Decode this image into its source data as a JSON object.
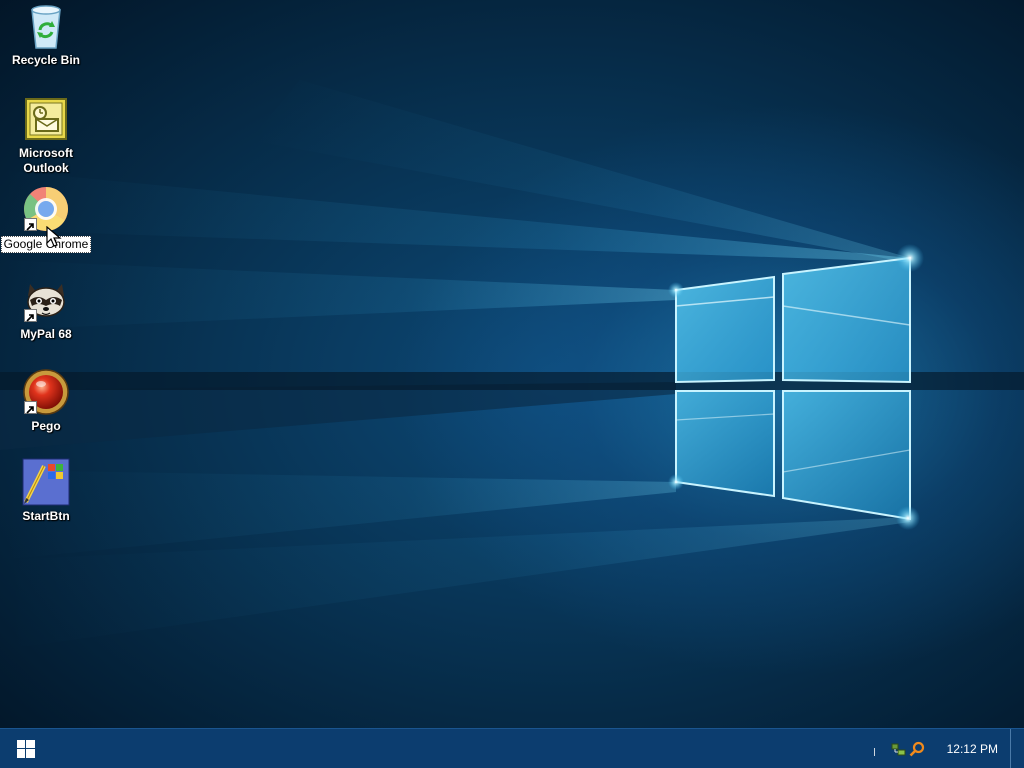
{
  "desktop": {
    "icons": [
      {
        "label": "Recycle Bin",
        "icon": "recycle-bin-icon"
      },
      {
        "label": "Microsoft Outlook",
        "icon": "outlook-icon"
      },
      {
        "label": "Google Chrome",
        "icon": "chrome-icon",
        "selected": true,
        "shortcut": true
      },
      {
        "label": "MyPal 68",
        "icon": "mypal-raccoon-icon",
        "shortcut": true
      },
      {
        "label": "Pego",
        "icon": "pego-red-ball-icon",
        "shortcut": true
      },
      {
        "label": "StartBtn",
        "icon": "startbtn-icon"
      }
    ],
    "wallpaper": "windows-10-hero-light-window",
    "colors": {
      "background_dark": "#031a2e",
      "glow": "#5fd6ff"
    }
  },
  "taskbar": {
    "start_icon": "windows-logo-icon",
    "tray_icons": [
      "network-green-icon",
      "search-orange-icon"
    ],
    "clock": "12:12 PM",
    "colors": {
      "bar": "#0c3d6f"
    }
  }
}
